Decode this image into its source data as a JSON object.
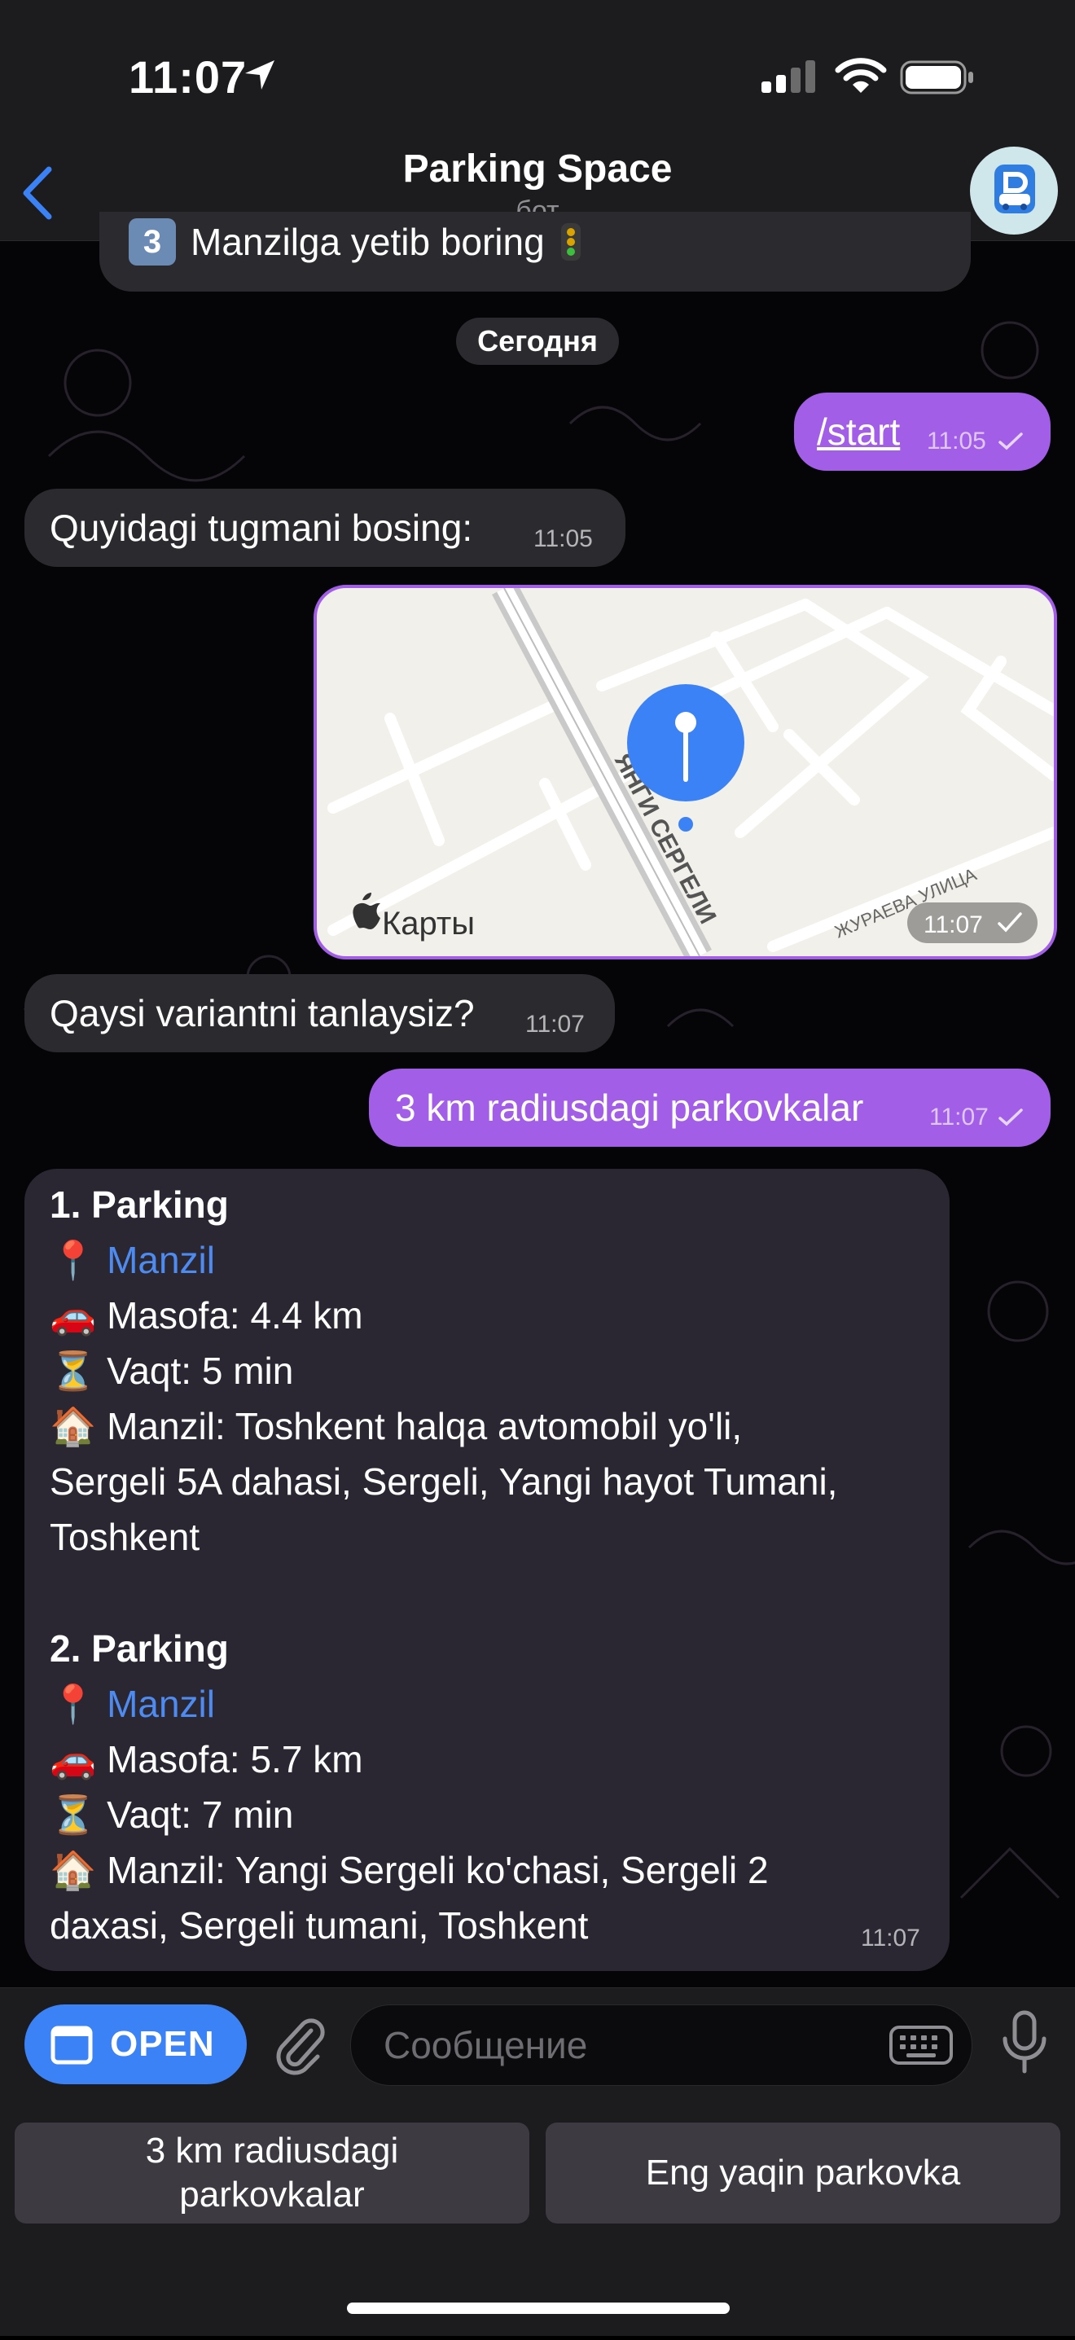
{
  "status_bar": {
    "time": "11:07"
  },
  "header": {
    "back_label": "",
    "title": "Parking Space",
    "subtitle": "бот"
  },
  "chat": {
    "partial_message": "Manzilga yetib boring",
    "date_pill": "Сегодня",
    "messages": [
      {
        "id": "start",
        "text": "/start",
        "time": "11:05"
      },
      {
        "id": "press_button",
        "text": "Quyidagi tugmani bosing:",
        "time": "11:05"
      },
      {
        "id": "location",
        "map_brand": "Карты",
        "street1": "ЯНГИ СЕРГЕЛИ",
        "street2": "ЖУРАЕВА УЛИЦА",
        "time": "11:07"
      },
      {
        "id": "which_variant",
        "text": "Qaysi variantni tanlaysiz?",
        "time": "11:07"
      },
      {
        "id": "radius_choice",
        "text": "3 km radiusdagi parkovkalar",
        "time": "11:07"
      }
    ],
    "parking_list": {
      "time": "11:07",
      "items": [
        {
          "title": "1. Parking",
          "manzil_link": "Manzil",
          "distance": "Masofa: 4.4 km",
          "duration": "Vaqt: 5 min",
          "address_lines": [
            "Manzil: Toshkent halqa avtomobil yo'li,",
            "Sergeli 5A dahasi, Sergeli, Yangi hayot Tumani,",
            "Toshkent"
          ]
        },
        {
          "title": "2. Parking",
          "manzil_link": "Manzil",
          "distance": "Masofa: 5.7 km",
          "duration": "Vaqt: 7 min",
          "address_lines": [
            "Manzil: Yangi Sergeli ko'chasi, Sergeli 2",
            "daxasi, Sergeli tumani, Toshkent"
          ]
        }
      ]
    }
  },
  "input_bar": {
    "open_label": "OPEN",
    "placeholder": "Сообщение"
  },
  "keyboard": {
    "buttons": [
      {
        "label_line1": "3 km radiusdagi",
        "label_line2": "parkovkalar"
      },
      {
        "label_line1": "Eng yaqin parkovka",
        "label_line2": ""
      }
    ]
  },
  "colors": {
    "accent": "#a35ee8",
    "link": "#4e8bf0",
    "open_button": "#3b82f6",
    "map_pin": "#3b82f6"
  }
}
